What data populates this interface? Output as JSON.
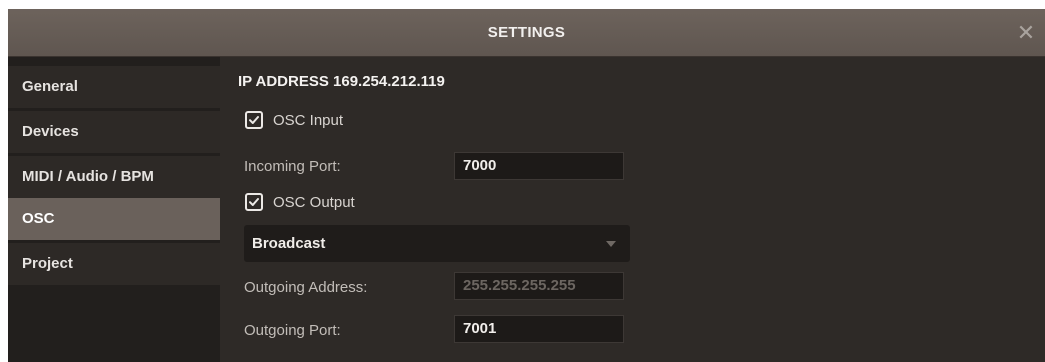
{
  "window": {
    "title": "SETTINGS",
    "close_glyph": "✕"
  },
  "sidebar": {
    "items": [
      {
        "label": "General",
        "active": false
      },
      {
        "label": "Devices",
        "active": false
      },
      {
        "label": "MIDI / Audio / BPM",
        "active": false
      },
      {
        "label": "OSC",
        "active": true
      },
      {
        "label": "Project",
        "active": false
      }
    ]
  },
  "osc": {
    "ip_address": "IP ADDRESS 169.254.212.119",
    "input": {
      "label": "OSC Input",
      "checked": true
    },
    "incoming_port": {
      "label": "Incoming Port:",
      "value": "7000"
    },
    "output": {
      "label": "OSC Output",
      "checked": true
    },
    "mode": {
      "selected": "Broadcast"
    },
    "outgoing_address": {
      "label": "Outgoing Address:",
      "value": "255.255.255.255",
      "disabled": true
    },
    "outgoing_port": {
      "label": "Outgoing Port:",
      "value": "7001"
    }
  },
  "colors": {
    "window_bg": "#2e2a27",
    "titlebar": "#655c56",
    "active_tab": "#6a615b",
    "input_bg": "#1d1a18"
  }
}
